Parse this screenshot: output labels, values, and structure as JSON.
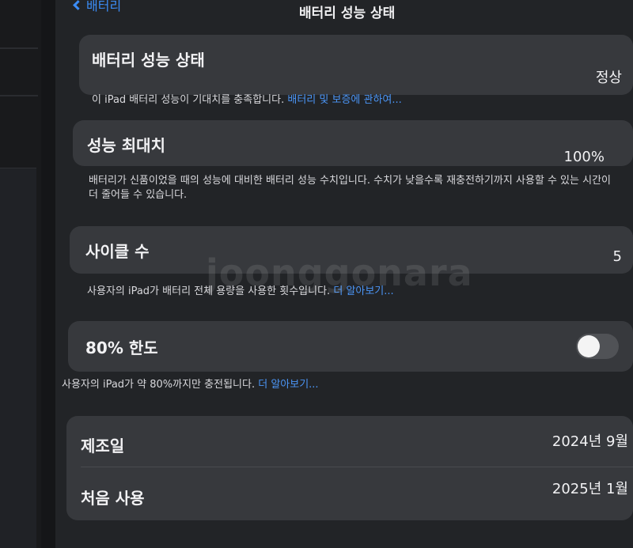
{
  "nav": {
    "back_label": "배터리",
    "title": "배터리 성능 상태"
  },
  "battery_health": {
    "title": "배터리 성능 상태",
    "value": "정상",
    "footnote": "이 iPad 배터리 성능이 기대치를 충족합니다.",
    "link": "배터리 및 보증에 관하여..."
  },
  "max_capacity": {
    "title": "성능 최대치",
    "value": "100%",
    "footnote": "배터리가 신품이었을 때의 성능에 대비한 배터리 성능 수치입니다. 수치가 낮을수록 재충전하기까지 사용할 수 있는 시간이 더 줄어들 수 있습니다."
  },
  "cycle_count": {
    "title": "사이클 수",
    "value": "5",
    "footnote": "사용자의 iPad가 배터리 전체 용량을 사용한 횟수입니다.",
    "link": "더 알아보기..."
  },
  "limit_80": {
    "title": "80% 한도",
    "enabled": false,
    "footnote": "사용자의 iPad가 약 80%까지만 충전됩니다.",
    "link": "더 알아보기..."
  },
  "dates": {
    "manufacture_label": "제조일",
    "manufacture_value": "2024년 9월",
    "first_use_label": "처음 사용",
    "first_use_value": "2025년 1월"
  },
  "watermark": {
    "text": "joonggonara"
  },
  "colors": {
    "link": "#4b95f6",
    "card": "#37393d",
    "background": "#222427"
  }
}
